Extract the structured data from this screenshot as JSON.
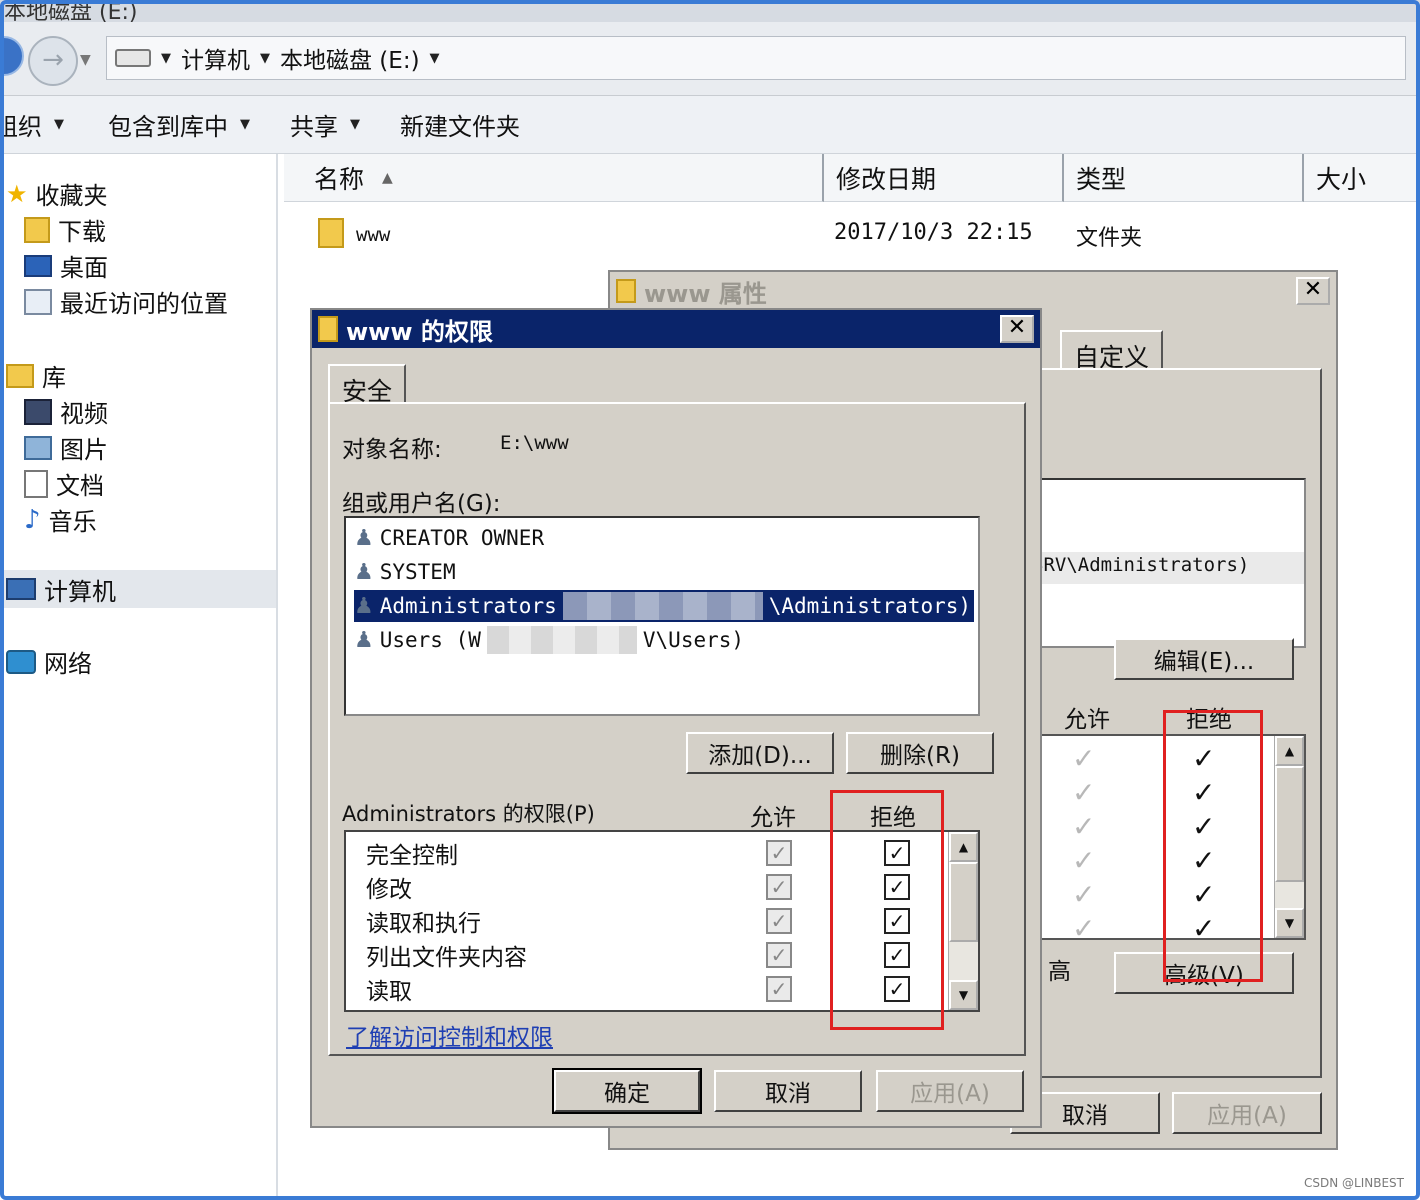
{
  "window": {
    "title_fragment": "本地磁盘 (E:)"
  },
  "address": {
    "crumbs": [
      "计算机",
      "本地磁盘 (E:)"
    ]
  },
  "toolbar": {
    "organize": "组织",
    "include_in_library": "包含到库中",
    "share": "共享",
    "new_folder": "新建文件夹"
  },
  "nav": {
    "favorites": "收藏夹",
    "downloads": "下载",
    "desktop": "桌面",
    "recent": "最近访问的位置",
    "libraries": "库",
    "videos": "视频",
    "pictures": "图片",
    "documents": "文档",
    "music": "音乐",
    "computer": "计算机",
    "network": "网络"
  },
  "columns": {
    "name": "名称",
    "modified": "修改日期",
    "type": "类型",
    "size": "大小"
  },
  "files": [
    {
      "name": "www",
      "modified": "2017/10/3 22:15",
      "type": "文件夹"
    }
  ],
  "properties_dialog": {
    "title": "www 属性",
    "tab_custom": "自定义",
    "admins_fragment": "SRV\\Administrators)",
    "edit_button": "编辑(E)...",
    "allow_header": "允许",
    "deny_header": "拒绝",
    "advanced_label_fragment": "高",
    "advanced_button": "高级(V)",
    "cancel_button": "取消",
    "apply_button": "应用(A)"
  },
  "perm_dialog": {
    "title": "www 的权限",
    "tab_security": "安全",
    "object_name_label": "对象名称:",
    "object_name_value": "E:\\www",
    "group_label": "组或用户名(G):",
    "users": [
      {
        "prefix": "CREATOR OWNER",
        "suffix": ""
      },
      {
        "prefix": "SYSTEM",
        "suffix": ""
      },
      {
        "prefix": "Administrators",
        "suffix": "\\Administrators)"
      },
      {
        "prefix": "Users (W",
        "suffix": "V\\Users)"
      }
    ],
    "add_button": "添加(D)...",
    "remove_button": "删除(R)",
    "perm_label": "Administrators 的权限(P)",
    "allow_header": "允许",
    "deny_header": "拒绝",
    "permissions": [
      "完全控制",
      "修改",
      "读取和执行",
      "列出文件夹内容",
      "读取"
    ],
    "link": "了解访问控制和权限",
    "ok_button": "确定",
    "cancel_button": "取消",
    "apply_button": "应用(A)"
  },
  "watermark": "CSDN @LINBEST",
  "colors": {
    "active_title": "#0a246a",
    "dialog_face": "#d4d0c8",
    "highlight_box": "#e02020",
    "link": "#1f3fb3",
    "frame": "#3a7bd5"
  }
}
